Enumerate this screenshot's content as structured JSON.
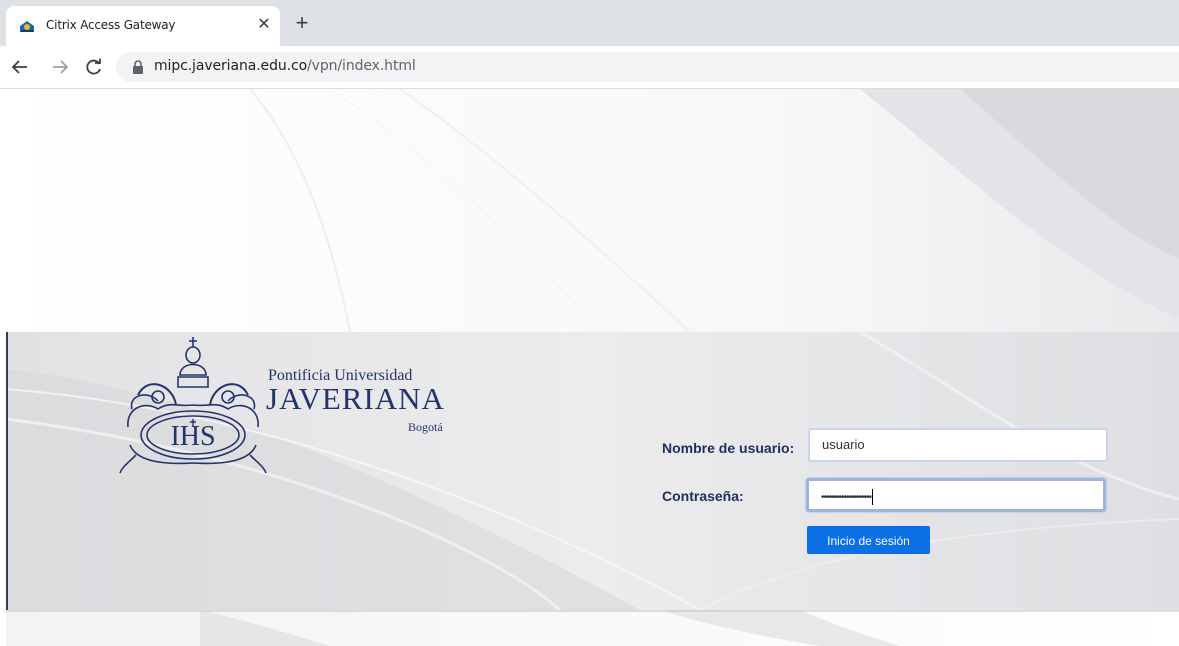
{
  "browser": {
    "tab_title": "Citrix Access Gateway",
    "tab_close": "✕",
    "new_tab": "+",
    "url_host": "mipc.javeriana.edu.co",
    "url_path": "/vpn/index.html",
    "icons": [
      "citrix-favicon-icon",
      "close-icon",
      "plus-icon",
      "back-arrow-icon",
      "forward-arrow-icon",
      "reload-icon",
      "lock-icon"
    ]
  },
  "logo": {
    "line1": "Pontificia Universidad",
    "line2": "JAVERIANA",
    "line3": "Bogotá",
    "monogram": "IHS"
  },
  "login": {
    "username_label": "Nombre de usuario:",
    "username_value": "usuario",
    "password_label": "Contraseña:",
    "password_mask": "••••••••••••••••••••",
    "submit_label": "Inicio de sesión"
  },
  "colors": {
    "brand_navy": "#1d2e5c",
    "button_blue": "#0b70e6",
    "band_gray": "#dcdcdf"
  }
}
